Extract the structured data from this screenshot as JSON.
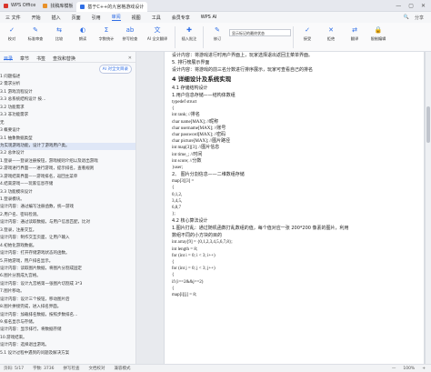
{
  "titlebar": {
    "tabs": [
      {
        "label": "WPS Office",
        "color": "#d9342b"
      },
      {
        "label": "找稿库模板",
        "color": "#e8912a"
      },
      {
        "label": "基于C++的九宫格游戏设计",
        "color": "#2f6ee5"
      }
    ],
    "controls": [
      "—",
      "▢",
      "✕"
    ]
  },
  "menubar": {
    "items": [
      "三 文件",
      "开始",
      "插入",
      "页面",
      "引用",
      "审阅",
      "视图",
      "工具",
      "会员专享",
      "WPS AI"
    ],
    "active_index": 5,
    "right": [
      "🔍",
      "分享"
    ]
  },
  "ribbon": {
    "items": [
      {
        "label": "校对",
        "icon": "✓"
      },
      {
        "label": "标准审查",
        "icon": "✎"
      },
      {
        "label": "比较",
        "icon": "⇆"
      },
      {
        "label": "朗读",
        "icon": "◐"
      },
      {
        "label": "字数统计",
        "icon": "Σ"
      },
      {
        "label": "拼写检查",
        "icon": "ab"
      },
      {
        "label": "AI 全文翻译",
        "icon": "文"
      },
      {
        "label": "插入批注",
        "icon": "✚"
      },
      {
        "label": "修订",
        "icon": "✎"
      }
    ],
    "select_value": "显示标记的最终状态",
    "right_items": [
      {
        "label": "接受",
        "icon": "✓"
      },
      {
        "label": "拒绝",
        "icon": "✕"
      },
      {
        "label": "翻译",
        "icon": "⇄"
      },
      {
        "label": "限制编辑",
        "icon": "🔒"
      }
    ]
  },
  "sidebar": {
    "tabs": [
      "目录",
      "章节",
      "书签",
      "查找和替换"
    ],
    "ai_button": "AI 对全文目录",
    "toc": [
      "1 问题描述",
      "   2 需求分析",
      "   3.1 游戏流程设计",
      "3.3 总系统结构设计  按…",
      "   3.2 功能需求",
      "   3.3 非功能需求",
      "      无",
      "3 概要设计",
      "   3.1 抽象数据类型",
      "为实现游戏功能，设计了游戏用户类。",
      "   3.2 总体设计",
      "1.登录——登录注册按钮，游戏规则介绍以及退出游戏",
      "2.游戏进行界面——进行游戏，提示排名，查看规则",
      "3.游戏结束界面——游戏排名，返回主菜单",
      "4.结束游戏——玩家信息存储",
      "   3.3 功能模块设计",
      "   1.登录模块。",
      "   设计内容：通过编写注册函数，统一游戏",
      "   2.用户名、密码检测。",
      "   设计内容：通过读取数据，与用户信息匹配，比对",
      "   3.登录，注册交互。",
      "   设计内容：制作交互页面，让用户输入",
      "   4.初始化游戏数据。",
      "   设计内容：打开存储游戏状态的函数。",
      "   5.开始游戏，用户排名显示。",
      "   设计内容：读取图片数据，将图片分割成固定",
      "   6.图片分割成九宫格。",
      "   设计内容：设计九宫格第一张图片切割成 3*3 ",
      "   7.图片移动。",
      "   设计内容：设计三个按钮，移动图片后",
      "   8.图片拼接完成，进入排名界面。",
      "   设计内容：加载排名数据，按照步数排名…",
      "   9.排名显示与存储。",
      "   设计内容：显示排行，将数据存储",
      "   10.游戏结束。",
      "   设计内容：选择退出游戏。",
      "   5.1 设计过程中遇到的问题及解决方案"
    ],
    "selected_index": 9
  },
  "document": {
    "lines": [
      {
        "t": "设计内容：将游戏进行时用户界面上，玩家选择退出返回主菜单界面。",
        "k": "p"
      },
      {
        "t": "5.   排行榜展示界面",
        "k": "p"
      },
      {
        "t": "设计内容：将游戏的前三名分数进行排序展示，玩家可查看自己的排名",
        "k": "p"
      },
      {
        "t": "4 详细设计及系统实现",
        "k": "h"
      },
      {
        "t": "4.1  存储结构设计",
        "k": "p"
      },
      {
        "t": "1.用户信息存储——结构体数组",
        "k": "p"
      },
      {
        "t": "typedef struct",
        "k": "c"
      },
      {
        "t": "{",
        "k": "c"
      },
      {
        "t": "        int rank;                //排名",
        "k": "c"
      },
      {
        "t": "        char name[MAX];        //昵称",
        "k": "c"
      },
      {
        "t": "        char username[MAX]; //账号",
        "k": "c"
      },
      {
        "t": "        char password[MAX]; //密码",
        "k": "c"
      },
      {
        "t": "        char picture[MAX];  //图片路径",
        "k": "c"
      },
      {
        "t": "        int map[3][3];  //图片信息",
        "k": "c"
      },
      {
        "t": "        int time_;  //时间",
        "k": "c"
      },
      {
        "t": "        int score;  //分数",
        "k": "c"
      },
      {
        "t": "}user;",
        "k": "c"
      },
      {
        "t": "2、  图片分割信息——二维数组存储",
        "k": "p"
      },
      {
        "t": "map[3][3] =",
        "k": "c"
      },
      {
        "t": "{",
        "k": "c"
      },
      {
        "t": "        0,1,2,",
        "k": "c"
      },
      {
        "t": "        3,4,5,",
        "k": "c"
      },
      {
        "t": "        6,8,7",
        "k": "c"
      },
      {
        "t": "};",
        "k": "c"
      },
      {
        "t": "4.2  核心算法设计",
        "k": "p"
      },
      {
        "t": "1.图片打乱：通过随机函数打乱数组的值，每个值对应一张 200*200 像素的图片，利用",
        "k": "p"
      },
      {
        "t": "数组不同的小方块的目的",
        "k": "p"
      },
      {
        "t": "        int array[9] = {0,1,2,3,4,5,6,7,8};",
        "k": "c"
      },
      {
        "t": "        int length = 8;",
        "k": "c"
      },
      {
        "t": "        for (int i = 0; i < 3; i++)",
        "k": "c"
      },
      {
        "t": "        {",
        "k": "c"
      },
      {
        "t": "                for (int j = 0; j < 3; j++)",
        "k": "c"
      },
      {
        "t": "                {",
        "k": "c"
      },
      {
        "t": "                        if (i==2&&j==2)",
        "k": "c"
      },
      {
        "t": "                        {",
        "k": "c"
      },
      {
        "t": "                                map[i][j] = 8;",
        "k": "c"
      }
    ]
  },
  "statusbar": {
    "items": [
      "页码: 5/17",
      "字数: 3736",
      "拼写检查",
      "文档校对",
      "兼容模式"
    ],
    "right": [
      "—",
      "100%",
      "+"
    ]
  }
}
